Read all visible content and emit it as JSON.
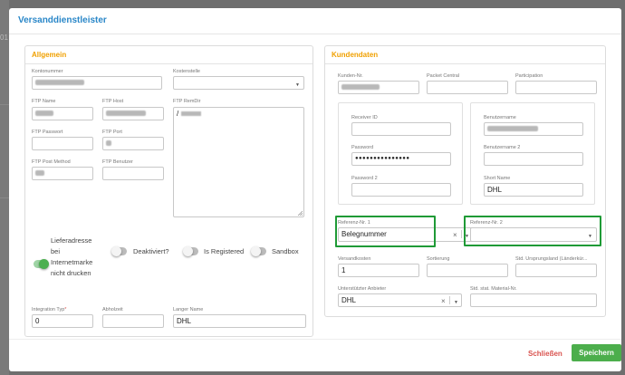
{
  "modal": {
    "title": "Versanddienstleister"
  },
  "allgemein": {
    "title": "Allgemein",
    "kontonummer_label": "Kontonummer",
    "kostenstelle_label": "Kostenstelle",
    "ftp_name_label": "FTP Name",
    "ftp_host_label": "FTP Host",
    "ftp_remdir_label": "FTP RemDir",
    "ftp_remdir_value": "/",
    "ftp_passwort_label": "FTP Passwort",
    "ftp_port_label": "FTP Port",
    "ftp_post_method_label": "FTP Post Method",
    "ftp_benutzer_label": "FTP Benutzer",
    "lieferadresse_label": "Lieferadresse bei Internetmarke nicht drucken",
    "lieferadresse_lines": [
      "Lieferadresse",
      "bei",
      "Internetmarke",
      "nicht drucken"
    ],
    "deaktiviert_label": "Deaktiviert?",
    "is_registered_label": "Is Registered",
    "sandbox_label": "Sandbox",
    "integration_typ_label": "Integration Typ",
    "integration_typ_required": "*",
    "integration_typ_value": "0",
    "abholzeit_label": "Abholzeit",
    "langer_name_label": "Langer Name",
    "langer_name_value": "DHL"
  },
  "kundendaten": {
    "title": "Kundendaten",
    "kunden_nr_label": "Kunden-Nr.",
    "packet_central_label": "Packet Central",
    "participation_label": "Participation",
    "receiver_id_label": "Receiver ID",
    "password_label": "Password",
    "password_value": "●●●●●●●●●●●●●●●",
    "password2_label": "Password 2",
    "benutzername_label": "Benutzername",
    "benutzername2_label": "Benutzername 2",
    "short_name_label": "Short Name",
    "short_name_value": "DHL",
    "referenz1_label": "Referenz-Nr. 1",
    "referenz1_value": "Belegnummer",
    "referenz2_label": "Referenz-Nr. 2",
    "versandkosten_label": "Versandkosten",
    "versandkosten_value": "1",
    "sortierung_label": "Sortierung",
    "ursprungsland_label": "Std. Ursprungsland (Länderkür...",
    "unterstuetzter_anbieter_label": "Unterstützter Anbieter",
    "unterstuetzter_anbieter_value": "DHL",
    "material_nr_label": "Std. stat. Material-Nr."
  },
  "footer": {
    "close_label": "Schließen",
    "save_label": "Speichern"
  },
  "icons": {
    "clear": "×",
    "caret": "▼"
  },
  "colors": {
    "title": "#2a87c8",
    "section": "#f0a000",
    "highlight": "#1f9a36",
    "save": "#4cae4c",
    "close": "#d9534f",
    "toggle_on": "#4caf50"
  }
}
